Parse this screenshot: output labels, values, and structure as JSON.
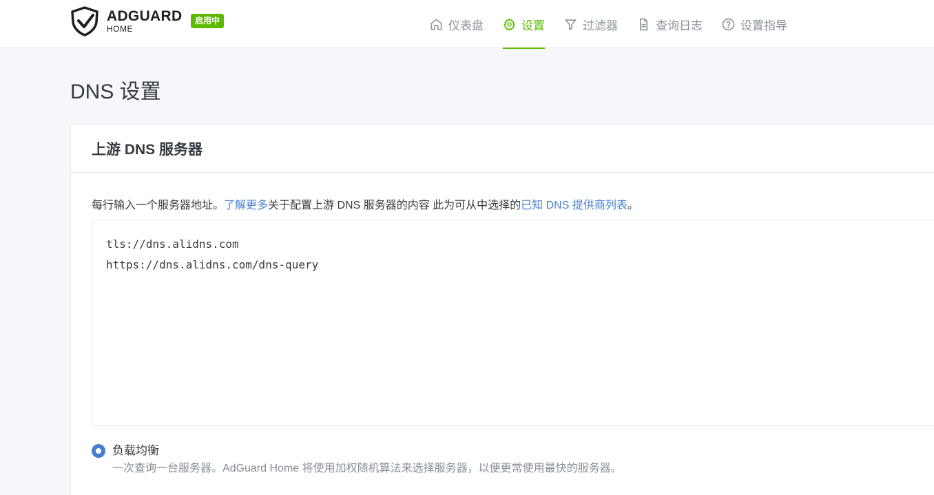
{
  "header": {
    "brand_name": "ADGUARD",
    "brand_sub": "HOME",
    "status_badge": "启用中",
    "nav": [
      {
        "label": "仪表盘",
        "icon": "home-icon",
        "active": false
      },
      {
        "label": "设置",
        "icon": "gear-icon",
        "active": true
      },
      {
        "label": "过滤器",
        "icon": "filter-icon",
        "active": false
      },
      {
        "label": "查询日志",
        "icon": "document-icon",
        "active": false
      },
      {
        "label": "设置指导",
        "icon": "help-circle-icon",
        "active": false
      }
    ]
  },
  "page": {
    "title": "DNS 设置"
  },
  "upstream": {
    "card_title": "上游 DNS 服务器",
    "help_prefix": "每行输入一个服务器地址。",
    "help_link1": "了解更多",
    "help_middle": "关于配置上游 DNS 服务器的内容 此为可从中选择的",
    "help_link2": "已知 DNS 提供商列表",
    "help_suffix": "。",
    "servers": "tls://dns.alidns.com\nhttps://dns.alidns.com/dns-query",
    "mode_label": "负载均衡",
    "mode_desc": "一次查询一台服务器。AdGuard Home 将使用加权随机算法来选择服务器，以便更常使用最快的服务器。"
  },
  "colors": {
    "accent_green": "#5eba00",
    "link_blue": "#467fcf"
  }
}
